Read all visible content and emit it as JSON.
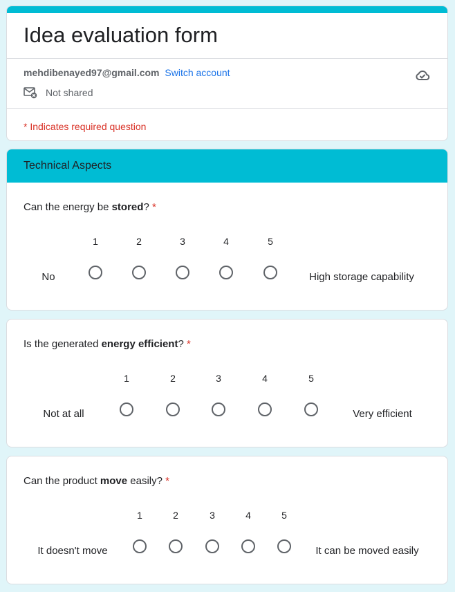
{
  "form": {
    "title": "Idea evaluation form",
    "account_email": "mehdibenayed97@gmail.com",
    "switch_account": "Switch account",
    "not_shared": "Not shared",
    "required_note": "* Indicates required question"
  },
  "section": {
    "title": "Technical Aspects"
  },
  "questions": [
    {
      "text_before": "Can the energy be ",
      "bold": "stored",
      "text_after": "?",
      "required_mark": "*",
      "scale": [
        "1",
        "2",
        "3",
        "4",
        "5"
      ],
      "min_label": "No",
      "max_label": "High storage capability",
      "selected": null
    },
    {
      "text_before": "Is the generated ",
      "bold": "energy efficient",
      "text_after": "?",
      "required_mark": "*",
      "scale": [
        "1",
        "2",
        "3",
        "4",
        "5"
      ],
      "min_label": "Not at all",
      "max_label": "Very efficient",
      "selected": null
    },
    {
      "text_before": "Can the product ",
      "bold": "move",
      "text_after": " easily?",
      "required_mark": "*",
      "scale": [
        "1",
        "2",
        "3",
        "4",
        "5"
      ],
      "min_label": "It doesn't move",
      "max_label": "It can be moved easily",
      "selected": null
    }
  ],
  "colors": {
    "accent": "#00bcd4",
    "background": "#e0f5f9",
    "required": "#d93025",
    "link": "#1a73e8"
  },
  "icons": {
    "cloud": "cloud-check-icon",
    "mail": "mail-not-shared-icon"
  }
}
